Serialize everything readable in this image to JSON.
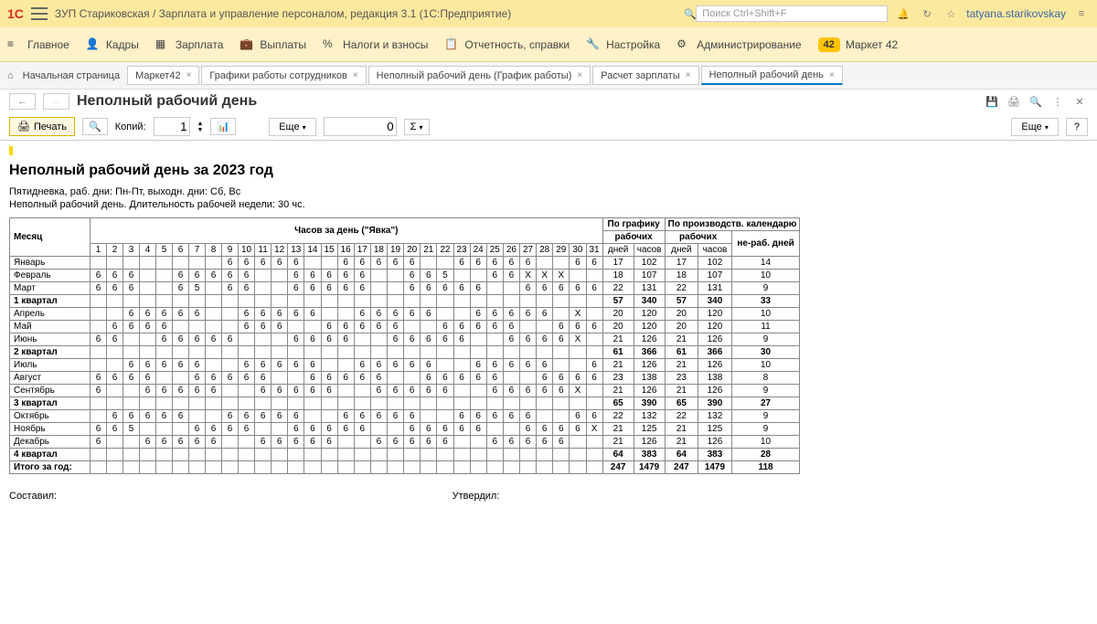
{
  "titlebar": {
    "app_title": "ЗУП Стариковская / Зарплата и управление персоналом, редакция 3.1 (1С:Предприятие)",
    "search_placeholder": "Поиск Ctrl+Shift+F",
    "username": "tatyana.starikovskay"
  },
  "nav": {
    "items": [
      "Главное",
      "Кадры",
      "Зарплата",
      "Выплаты",
      "Налоги и взносы",
      "Отчетность, справки",
      "Настройка",
      "Администрирование",
      "Маркет 42"
    ],
    "badge": "42"
  },
  "tabs": {
    "start": "Начальная страница",
    "items": [
      "Маркет42",
      "Графики работы сотрудников",
      "Неполный рабочий день (График работы)",
      "Расчет зарплаты",
      "Неполный рабочий день"
    ],
    "active_index": 4
  },
  "page": {
    "title": "Неполный рабочий день"
  },
  "toolbar": {
    "print": "Печать",
    "copies_label": "Копий:",
    "copies_value": "1",
    "more": "Еще",
    "other_value": "0",
    "sigma": "Σ",
    "right_more": "Еще",
    "help": "?"
  },
  "report": {
    "title": "Неполный рабочий день за 2023 год",
    "line1": "Пятидневка, раб. дни: Пн-Пт, выходн. дни: Сб, Вс",
    "line2": "Неполный рабочий день. Длительность рабочей недели: 30 чс.",
    "h_month": "Месяц",
    "h_hours": "Часов за день (\"Явка\")",
    "h_schedule": "По графику",
    "h_calendar": "По производств. календарю",
    "h_work": "рабочих",
    "h_off": "не-раб. дней",
    "h_days": "дней",
    "h_hours2": "часов",
    "day_nums": [
      "1",
      "2",
      "3",
      "4",
      "5",
      "6",
      "7",
      "8",
      "9",
      "10",
      "11",
      "12",
      "13",
      "14",
      "15",
      "16",
      "17",
      "18",
      "19",
      "20",
      "21",
      "22",
      "23",
      "24",
      "25",
      "26",
      "27",
      "28",
      "29",
      "30",
      "31"
    ],
    "rows": [
      {
        "label": "Январь",
        "d": [
          "",
          "",
          "",
          "",
          "",
          "",
          "",
          "",
          "6",
          "6",
          "6",
          "6",
          "6",
          "",
          "",
          "6",
          "6",
          "6",
          "6",
          "6",
          "",
          "",
          "6",
          "6",
          "6",
          "6",
          "6",
          "",
          "",
          "6",
          "6"
        ],
        "s": [
          "17",
          "102",
          "17",
          "102",
          "14"
        ]
      },
      {
        "label": "Февраль",
        "d": [
          "6",
          "6",
          "6",
          "",
          "",
          "6",
          "6",
          "6",
          "6",
          "6",
          "",
          "",
          "6",
          "6",
          "6",
          "6",
          "6",
          "",
          "",
          "6",
          "6",
          "5",
          "",
          "",
          "6",
          "6",
          "X",
          "X",
          "X",
          "",
          ""
        ],
        "s": [
          "18",
          "107",
          "18",
          "107",
          "10"
        ]
      },
      {
        "label": "Март",
        "d": [
          "6",
          "6",
          "6",
          "",
          "",
          "6",
          "5",
          "",
          "6",
          "6",
          "",
          "",
          "6",
          "6",
          "6",
          "6",
          "6",
          "",
          "",
          "6",
          "6",
          "6",
          "6",
          "6",
          "",
          "",
          "6",
          "6",
          "6",
          "6",
          "6"
        ],
        "s": [
          "22",
          "131",
          "22",
          "131",
          "9"
        ]
      },
      {
        "label": "1 квартал",
        "q": true,
        "d": [
          "",
          "",
          "",
          "",
          "",
          "",
          "",
          "",
          "",
          "",
          "",
          "",
          "",
          "",
          "",
          "",
          "",
          "",
          "",
          "",
          "",
          "",
          "",
          "",
          "",
          "",
          "",
          "",
          "",
          "",
          ""
        ],
        "s": [
          "57",
          "340",
          "57",
          "340",
          "33"
        ]
      },
      {
        "label": "Апрель",
        "d": [
          "",
          "",
          "6",
          "6",
          "6",
          "6",
          "6",
          "",
          "",
          "6",
          "6",
          "6",
          "6",
          "6",
          "",
          "",
          "6",
          "6",
          "6",
          "6",
          "6",
          "",
          "",
          "6",
          "6",
          "6",
          "6",
          "6",
          "",
          "X",
          ""
        ],
        "s": [
          "20",
          "120",
          "20",
          "120",
          "10"
        ]
      },
      {
        "label": "Май",
        "d": [
          "",
          "6",
          "6",
          "6",
          "6",
          "",
          "",
          "",
          "",
          "6",
          "6",
          "6",
          "",
          "",
          "6",
          "6",
          "6",
          "6",
          "6",
          "",
          "",
          "6",
          "6",
          "6",
          "6",
          "6",
          "",
          "",
          "6",
          "6",
          "6"
        ],
        "s": [
          "20",
          "120",
          "20",
          "120",
          "11"
        ]
      },
      {
        "label": "Июнь",
        "d": [
          "6",
          "6",
          "",
          "",
          "6",
          "6",
          "6",
          "6",
          "6",
          "",
          "",
          "",
          "6",
          "6",
          "6",
          "6",
          "",
          "",
          "6",
          "6",
          "6",
          "6",
          "6",
          "",
          "",
          "6",
          "6",
          "6",
          "6",
          "X",
          ""
        ],
        "s": [
          "21",
          "126",
          "21",
          "126",
          "9"
        ]
      },
      {
        "label": "2 квартал",
        "q": true,
        "d": [
          "",
          "",
          "",
          "",
          "",
          "",
          "",
          "",
          "",
          "",
          "",
          "",
          "",
          "",
          "",
          "",
          "",
          "",
          "",
          "",
          "",
          "",
          "",
          "",
          "",
          "",
          "",
          "",
          "",
          "",
          ""
        ],
        "s": [
          "61",
          "366",
          "61",
          "366",
          "30"
        ]
      },
      {
        "label": "Июль",
        "d": [
          "",
          "",
          "6",
          "6",
          "6",
          "6",
          "6",
          "",
          "",
          "6",
          "6",
          "6",
          "6",
          "6",
          "",
          "",
          "6",
          "6",
          "6",
          "6",
          "6",
          "",
          "",
          "6",
          "6",
          "6",
          "6",
          "6",
          "",
          "",
          "6"
        ],
        "s": [
          "21",
          "126",
          "21",
          "126",
          "10"
        ]
      },
      {
        "label": "Август",
        "d": [
          "6",
          "6",
          "6",
          "6",
          "",
          "",
          "6",
          "6",
          "6",
          "6",
          "6",
          "",
          "",
          "6",
          "6",
          "6",
          "6",
          "6",
          "",
          "",
          "6",
          "6",
          "6",
          "6",
          "6",
          "",
          "",
          "6",
          "6",
          "6",
          "6"
        ],
        "s": [
          "23",
          "138",
          "23",
          "138",
          "8"
        ]
      },
      {
        "label": "Сентябрь",
        "d": [
          "6",
          "",
          "",
          "6",
          "6",
          "6",
          "6",
          "6",
          "",
          "",
          "6",
          "6",
          "6",
          "6",
          "6",
          "",
          "",
          "6",
          "6",
          "6",
          "6",
          "6",
          "",
          "",
          "6",
          "6",
          "6",
          "6",
          "6",
          "X",
          ""
        ],
        "s": [
          "21",
          "126",
          "21",
          "126",
          "9"
        ]
      },
      {
        "label": "3 квартал",
        "q": true,
        "d": [
          "",
          "",
          "",
          "",
          "",
          "",
          "",
          "",
          "",
          "",
          "",
          "",
          "",
          "",
          "",
          "",
          "",
          "",
          "",
          "",
          "",
          "",
          "",
          "",
          "",
          "",
          "",
          "",
          "",
          "",
          ""
        ],
        "s": [
          "65",
          "390",
          "65",
          "390",
          "27"
        ]
      },
      {
        "label": "Октябрь",
        "d": [
          "",
          "6",
          "6",
          "6",
          "6",
          "6",
          "",
          "",
          "6",
          "6",
          "6",
          "6",
          "6",
          "",
          "",
          "6",
          "6",
          "6",
          "6",
          "6",
          "",
          "",
          "6",
          "6",
          "6",
          "6",
          "6",
          "",
          "",
          "6",
          "6"
        ],
        "s": [
          "22",
          "132",
          "22",
          "132",
          "9"
        ]
      },
      {
        "label": "Ноябрь",
        "d": [
          "6",
          "6",
          "5",
          "",
          "",
          "",
          "6",
          "6",
          "6",
          "6",
          "",
          "",
          "6",
          "6",
          "6",
          "6",
          "6",
          "",
          "",
          "6",
          "6",
          "6",
          "6",
          "6",
          "",
          "",
          "6",
          "6",
          "6",
          "6",
          "X"
        ],
        "s": [
          "21",
          "125",
          "21",
          "125",
          "9"
        ]
      },
      {
        "label": "Декабрь",
        "d": [
          "6",
          "",
          "",
          "6",
          "6",
          "6",
          "6",
          "6",
          "",
          "",
          "6",
          "6",
          "6",
          "6",
          "6",
          "",
          "",
          "6",
          "6",
          "6",
          "6",
          "6",
          "",
          "",
          "6",
          "6",
          "6",
          "6",
          "6",
          "",
          ""
        ],
        "s": [
          "21",
          "126",
          "21",
          "126",
          "10"
        ]
      },
      {
        "label": "4 квартал",
        "q": true,
        "d": [
          "",
          "",
          "",
          "",
          "",
          "",
          "",
          "",
          "",
          "",
          "",
          "",
          "",
          "",
          "",
          "",
          "",
          "",
          "",
          "",
          "",
          "",
          "",
          "",
          "",
          "",
          "",
          "",
          "",
          "",
          ""
        ],
        "s": [
          "64",
          "383",
          "64",
          "383",
          "28"
        ]
      },
      {
        "label": "Итого за год:",
        "t": true,
        "d": [
          "",
          "",
          "",
          "",
          "",
          "",
          "",
          "",
          "",
          "",
          "",
          "",
          "",
          "",
          "",
          "",
          "",
          "",
          "",
          "",
          "",
          "",
          "",
          "",
          "",
          "",
          "",
          "",
          "",
          "",
          ""
        ],
        "s": [
          "247",
          "1479",
          "247",
          "1479",
          "118"
        ]
      }
    ],
    "sig_compiled": "Составил:",
    "sig_approved": "Утвердил:"
  }
}
